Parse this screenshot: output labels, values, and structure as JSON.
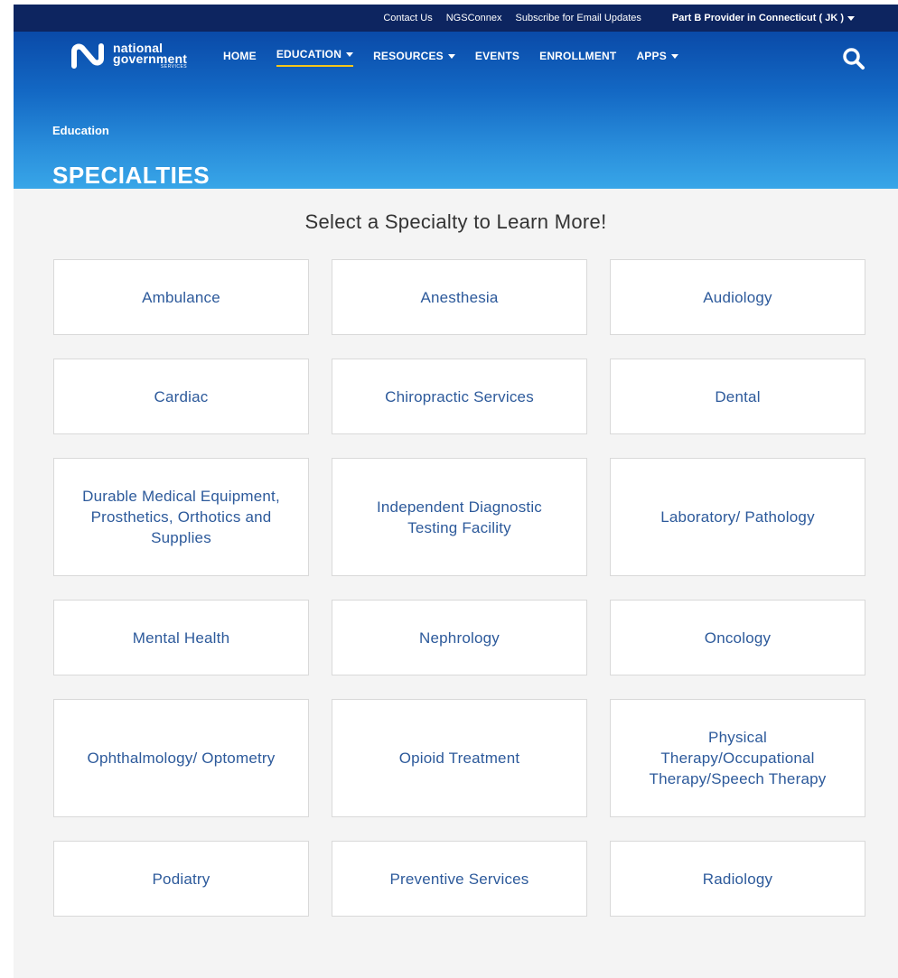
{
  "utility_bar": {
    "links": [
      "Contact Us",
      "NGSConnex",
      "Subscribe for Email Updates"
    ],
    "provider_selector": "Part B Provider in Connecticut ( JK )"
  },
  "logo": {
    "line1": "national",
    "line2": "government",
    "line3": "SERVICES"
  },
  "nav": {
    "home": "HOME",
    "education": "EDUCATION",
    "resources": "RESOURCES",
    "events": "EVENTS",
    "enrollment": "ENROLLMENT",
    "apps": "APPS"
  },
  "breadcrumb": "Education",
  "page_title": "SPECIALTIES",
  "section_heading": "Select a Specialty to Learn More!",
  "specialties": [
    "Ambulance",
    "Anesthesia",
    "Audiology",
    "Cardiac",
    "Chiropractic Services",
    "Dental",
    "Durable Medical Equipment, Prosthetics, Orthotics and Supplies",
    "Independent Diagnostic Testing Facility",
    "Laboratory/ Pathology",
    "Mental Health",
    "Nephrology",
    "Oncology",
    "Ophthalmology/ Optometry",
    "Opioid Treatment",
    "Physical Therapy/Occupational Therapy/Speech Therapy",
    "Podiatry",
    "Preventive Services",
    "Radiology"
  ],
  "colors": {
    "utility_bar": "#0d2560",
    "hero_top": "#0a4aa8",
    "hero_bottom": "#38a6e8",
    "nav_active_underline": "#f5c518",
    "card_text": "#2d5a9b",
    "page_background": "#f4f4f4"
  },
  "icons": {
    "logo": "ngs-logo-icon",
    "search": "search-icon",
    "dropdown": "caret-down-icon"
  }
}
